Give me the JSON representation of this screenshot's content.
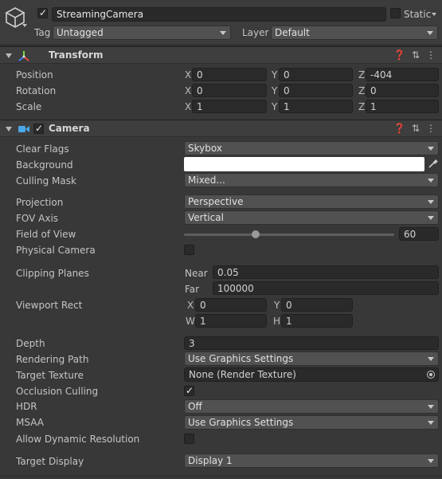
{
  "gameobject": {
    "name": "StreamingCamera",
    "active_checked": true,
    "static_label": "Static",
    "tag_label": "Tag",
    "tag_value": "Untagged",
    "layer_label": "Layer",
    "layer_value": "Default"
  },
  "transform": {
    "title": "Transform",
    "rows": [
      {
        "label": "Position",
        "x": "0",
        "y": "0",
        "z": "-404"
      },
      {
        "label": "Rotation",
        "x": "0",
        "y": "0",
        "z": "0"
      },
      {
        "label": "Scale",
        "x": "1",
        "y": "1",
        "z": "1"
      }
    ],
    "axis_labels": {
      "x": "X",
      "y": "Y",
      "z": "Z"
    }
  },
  "camera": {
    "title": "Camera",
    "enabled_checked": true,
    "clear_flags": {
      "label": "Clear Flags",
      "value": "Skybox"
    },
    "background": {
      "label": "Background",
      "color": "#ffffff"
    },
    "culling_mask": {
      "label": "Culling Mask",
      "value": "Mixed..."
    },
    "projection": {
      "label": "Projection",
      "value": "Perspective"
    },
    "fov_axis": {
      "label": "FOV Axis",
      "value": "Vertical"
    },
    "field_of_view": {
      "label": "Field of View",
      "value": "60",
      "slider_fraction": 0.34
    },
    "physical_camera": {
      "label": "Physical Camera",
      "checked": false
    },
    "clipping_planes": {
      "label": "Clipping Planes",
      "near_label": "Near",
      "near": "0.05",
      "far_label": "Far",
      "far": "100000"
    },
    "viewport_rect": {
      "label": "Viewport Rect",
      "x_label": "X",
      "x": "0",
      "y_label": "Y",
      "y": "0",
      "w_label": "W",
      "w": "1",
      "h_label": "H",
      "h": "1"
    },
    "depth": {
      "label": "Depth",
      "value": "3"
    },
    "rendering_path": {
      "label": "Rendering Path",
      "value": "Use Graphics Settings"
    },
    "target_texture": {
      "label": "Target Texture",
      "value": "None (Render Texture)"
    },
    "occlusion_culling": {
      "label": "Occlusion Culling",
      "checked": true
    },
    "hdr": {
      "label": "HDR",
      "value": "Off"
    },
    "msaa": {
      "label": "MSAA",
      "value": "Use Graphics Settings"
    },
    "allow_dynamic_resolution": {
      "label": "Allow Dynamic Resolution",
      "checked": false
    },
    "target_display": {
      "label": "Target Display",
      "value": "Display 1"
    }
  },
  "icons": {
    "gameobject": "cube-icon",
    "transform": "transform-axes-icon",
    "camera": "camera-icon",
    "help": "help-icon",
    "presets": "presets-icon",
    "more": "kebab-menu-icon",
    "eyedropper": "eyedropper-icon",
    "object_picker": "object-picker-icon"
  },
  "colors": {
    "panel_bg": "#383838",
    "field_bg": "#2a2a2a",
    "dropdown_bg": "#515151",
    "header_bg": "#3e3e3e",
    "camera_icon": "#4aa8e8"
  }
}
